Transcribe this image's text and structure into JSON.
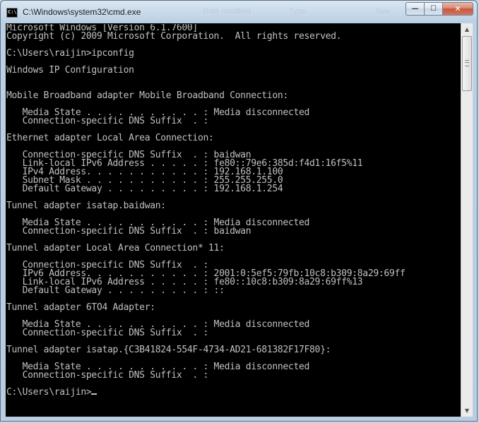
{
  "window": {
    "title": "C:\\Windows\\system32\\cmd.exe",
    "icon_label": "C:\\",
    "background_hints": [
      "Date modified",
      "Type",
      "Size"
    ],
    "controls": {
      "minimize_glyph": "—",
      "maximize_glyph": "☐",
      "close_glyph": "✕"
    }
  },
  "console": {
    "text_color": "#c0c0c0",
    "background_color": "#000000",
    "lines": [
      "Microsoft Windows [Version 6.1.7600]",
      "Copyright (c) 2009 Microsoft Corporation.  All rights reserved.",
      "",
      "C:\\Users\\raijin>ipconfig",
      "",
      "Windows IP Configuration",
      "",
      "",
      "Mobile Broadband adapter Mobile Broadband Connection:",
      "",
      "   Media State . . . . . . . . . . . : Media disconnected",
      "   Connection-specific DNS Suffix  . :",
      "",
      "Ethernet adapter Local Area Connection:",
      "",
      "   Connection-specific DNS Suffix  . : baidwan",
      "   Link-local IPv6 Address . . . . . : fe80::79e6:385d:f4d1:16f5%11",
      "   IPv4 Address. . . . . . . . . . . : 192.168.1.100",
      "   Subnet Mask . . . . . . . . . . . : 255.255.255.0",
      "   Default Gateway . . . . . . . . . : 192.168.1.254",
      "",
      "Tunnel adapter isatap.baidwan:",
      "",
      "   Media State . . . . . . . . . . . : Media disconnected",
      "   Connection-specific DNS Suffix  . : baidwan",
      "",
      "Tunnel adapter Local Area Connection* 11:",
      "",
      "   Connection-specific DNS Suffix  . :",
      "   IPv6 Address. . . . . . . . . . . : 2001:0:5ef5:79fb:10c8:b309:8a29:69ff",
      "   Link-local IPv6 Address . . . . . : fe80::10c8:b309:8a29:69ff%13",
      "   Default Gateway . . . . . . . . . : ::",
      "",
      "Tunnel adapter 6TO4 Adapter:",
      "",
      "   Media State . . . . . . . . . . . : Media disconnected",
      "   Connection-specific DNS Suffix  . :",
      "",
      "Tunnel adapter isatap.{C3B41824-554F-4734-AD21-681382F17F80}:",
      "",
      "   Media State . . . . . . . . . . . : Media disconnected",
      "   Connection-specific DNS Suffix  . :",
      ""
    ],
    "prompt": "C:\\Users\\raijin>"
  },
  "scrollbar": {
    "up_arrow_glyph": "▲",
    "down_arrow_glyph": "▼",
    "thumb_position_fraction": 0.0
  }
}
